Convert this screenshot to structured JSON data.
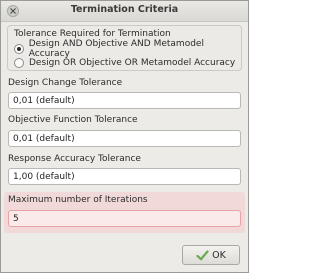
{
  "window": {
    "title": "Termination Criteria"
  },
  "termination_group": {
    "title": "Tolerance Required for Termination",
    "options": [
      {
        "label": "Design AND Objective AND Metamodel Accuracy",
        "selected": true
      },
      {
        "label": "Design OR Objective OR Metamodel Accuracy",
        "selected": false
      }
    ]
  },
  "fields": {
    "design_change": {
      "label": "Design Change Tolerance",
      "value": "0,01 (default)"
    },
    "objective_function": {
      "label": "Objective Function Tolerance",
      "value": "0,01 (default)"
    },
    "response_accuracy": {
      "label": "Response Accuracy Tolerance",
      "value": "1,00 (default)"
    },
    "max_iterations": {
      "label": "Maximum number of Iterations",
      "value": "5"
    }
  },
  "buttons": {
    "ok_label": "OK"
  },
  "icons": {
    "close": "close-icon",
    "ok": "checkmark-icon"
  },
  "colors": {
    "error_highlight": "#f2d9d9",
    "checkmark": "#6aa84f"
  }
}
